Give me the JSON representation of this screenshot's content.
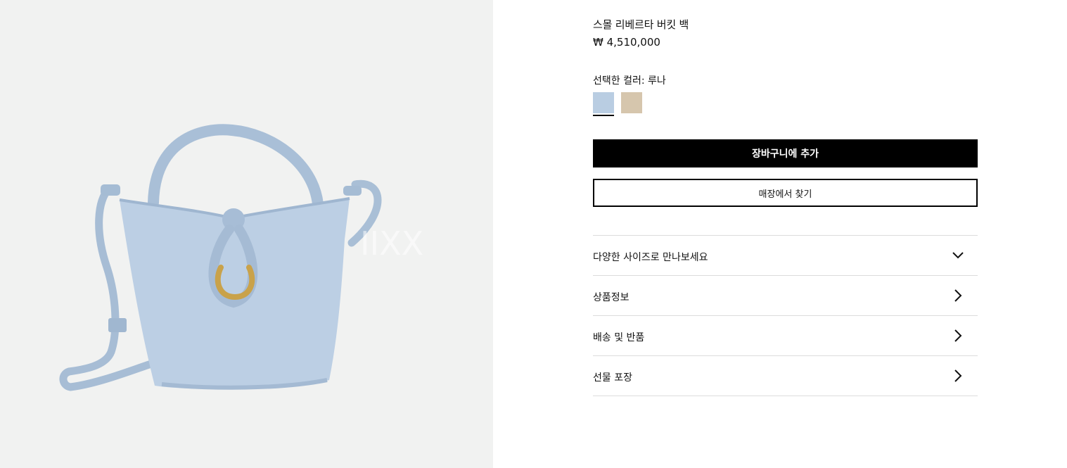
{
  "product": {
    "title": "스몰 리베르타 버킷 백",
    "price": "₩ 4,510,000",
    "image_watermark": "IIXX",
    "selected_color_label": "선택한 컬러: 루나",
    "swatches": [
      {
        "name": "루나",
        "color": "#b9cde2",
        "selected": true
      },
      {
        "name": "beige",
        "color": "#d6c6ad",
        "selected": false
      }
    ]
  },
  "actions": {
    "add_to_cart": "장바구니에 추가",
    "find_in_store": "매장에서 찾기"
  },
  "accordion": [
    {
      "label": "다양한 사이즈로 만나보세요",
      "icon": "chevron-down-icon"
    },
    {
      "label": "상품정보",
      "icon": "chevron-right-icon"
    },
    {
      "label": "배송 및 반품",
      "icon": "chevron-right-icon"
    },
    {
      "label": "선물 포장",
      "icon": "chevron-right-icon"
    }
  ],
  "colors": {
    "image_background": "#f1f2f1",
    "bag": "#b9cde2",
    "hardware": "#c9a24a",
    "button_primary": "#000000"
  }
}
